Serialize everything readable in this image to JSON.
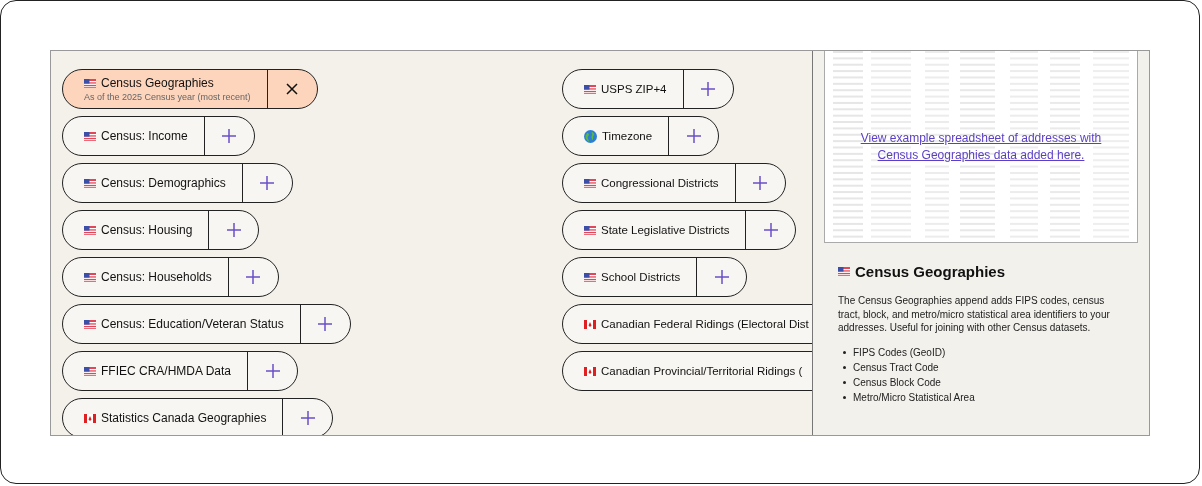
{
  "left_column": [
    {
      "kind": "us",
      "label": "Census Geographies",
      "sublabel": "As of the 2025 Census year (most recent)",
      "selected": true
    },
    {
      "kind": "us",
      "label": "Census: Income",
      "selected": false
    },
    {
      "kind": "us",
      "label": "Census: Demographics",
      "selected": false
    },
    {
      "kind": "us",
      "label": "Census: Housing",
      "selected": false
    },
    {
      "kind": "us",
      "label": "Census: Households",
      "selected": false
    },
    {
      "kind": "us",
      "label": "Census: Education/Veteran Status",
      "selected": false
    },
    {
      "kind": "us",
      "label": "FFIEC CRA/HMDA Data",
      "selected": false
    },
    {
      "kind": "ca",
      "label": "Statistics Canada Geographies",
      "selected": false
    }
  ],
  "right_column": [
    {
      "kind": "us",
      "label": "USPS ZIP+4",
      "selected": false
    },
    {
      "kind": "globe",
      "label": "Timezone",
      "selected": false
    },
    {
      "kind": "us",
      "label": "Congressional Districts",
      "selected": false
    },
    {
      "kind": "us",
      "label": "State Legislative Districts",
      "selected": false
    },
    {
      "kind": "us",
      "label": "School Districts",
      "selected": false
    },
    {
      "kind": "ca",
      "label": "Canadian Federal Ridings (Electoral Dist"
    },
    {
      "kind": "ca",
      "label": "Canadian Provincial/Territorial Ridings ("
    }
  ],
  "detail_panel": {
    "link": "View example spreadsheet of addresses with Census Geographies data added here.",
    "kind": "us",
    "title": "Census Geographies",
    "description": "The Census Geographies append adds FIPS codes, census tract, block, and metro/micro statistical area identifiers to your addresses. Useful for joining with other Census datasets.",
    "fields": [
      "FIPS Codes (GeoID)",
      "Census Tract Code",
      "Census Block Code",
      "Metro/Micro Statistical Area"
    ]
  }
}
